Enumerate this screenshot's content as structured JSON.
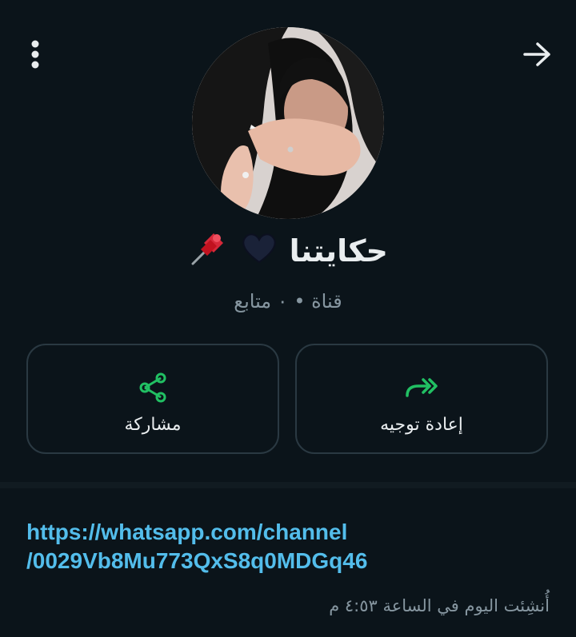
{
  "header": {
    "menu_icon": "more-vertical-icon",
    "back_icon": "arrow-right-icon"
  },
  "profile": {
    "avatar_alt": "channel-avatar",
    "name": "حكايتنا",
    "name_emojis": [
      "🖤",
      "📌"
    ],
    "subtitle": "قناة • ٠ متابع"
  },
  "actions": {
    "share": {
      "label": "مشاركة",
      "icon": "share-icon"
    },
    "forward": {
      "label": "إعادة توجيه",
      "icon": "forward-icon"
    }
  },
  "description": {
    "link_line1": "https://whatsapp.com/channel",
    "link_line2": "/0029Vb8Mu773QxS8q0MDGq46",
    "created": "أُنشِئت اليوم في الساعة ٤:٥٣ م"
  },
  "colors": {
    "background": "#0b141a",
    "accent_green": "#21c063",
    "link_blue": "#53bdeb",
    "muted": "#8696a0"
  }
}
